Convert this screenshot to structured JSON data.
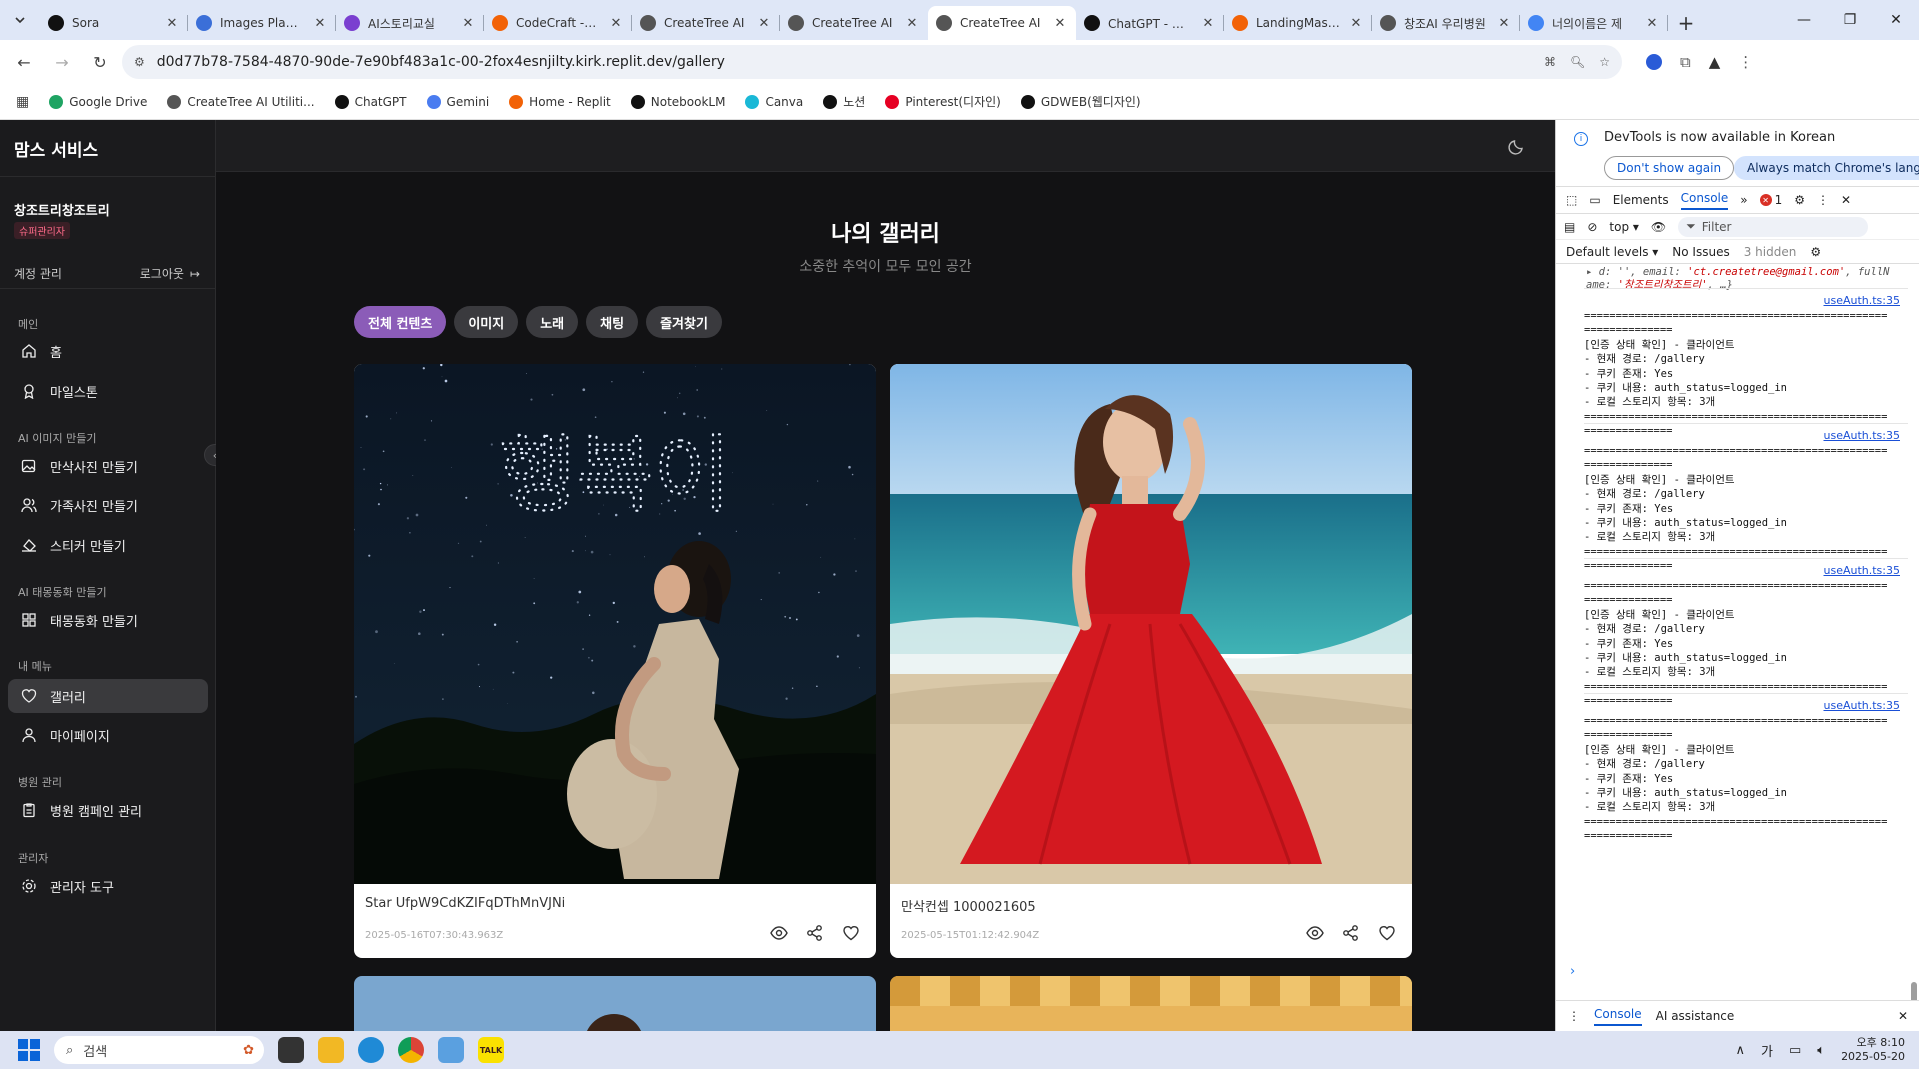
{
  "browser": {
    "tabs": [
      {
        "title": "Sora",
        "color": "#111111"
      },
      {
        "title": "Images Playground",
        "color": "#3b6fd8"
      },
      {
        "title": "AI스토리교실",
        "color": "#7a3fd0"
      },
      {
        "title": "CodeCraft - Replit",
        "color": "#f26207"
      },
      {
        "title": "CreateTree AI",
        "color": "#555555"
      },
      {
        "title": "CreateTree AI",
        "color": "#555555"
      },
      {
        "title": "CreateTree AI",
        "color": "#555555",
        "active": true
      },
      {
        "title": "ChatGPT - 창조",
        "color": "#111111"
      },
      {
        "title": "LandingMaster",
        "color": "#f26207"
      },
      {
        "title": "창조AI 우리병원",
        "color": "#555555"
      },
      {
        "title": "너의이름은 제",
        "color": "#4285f4"
      }
    ],
    "url": "d0d77b78-7584-4870-90de-7e90bf483a1c-00-2fox4esnjilty.kirk.replit.dev/gallery",
    "bookmarks": [
      {
        "label": "Google Drive",
        "color": "#1fa463"
      },
      {
        "label": "CreateTree AI Utiliti...",
        "color": "#555555"
      },
      {
        "label": "ChatGPT",
        "color": "#111111"
      },
      {
        "label": "Gemini",
        "color": "#4a7cf0"
      },
      {
        "label": "Home - Replit",
        "color": "#f26207"
      },
      {
        "label": "NotebookLM",
        "color": "#111111"
      },
      {
        "label": "Canva",
        "color": "#1ab8d6"
      },
      {
        "label": "노션",
        "color": "#111111"
      },
      {
        "label": "Pinterest(디자인)",
        "color": "#e60023"
      },
      {
        "label": "GDWEB(웹디자인)",
        "color": "#111111"
      }
    ]
  },
  "sidebar": {
    "brand": "맘스 서비스",
    "user_name": "창조트리창조트리",
    "role": "슈퍼관리자",
    "account_label": "계정 관리",
    "logout_label": "로그아웃",
    "sections": {
      "main": "메인",
      "ai_image": "AI 이미지 만들기",
      "ai_fetal": "AI 태몽동화 만들기",
      "my_menu": "내 메뉴",
      "hospital": "병원 관리",
      "admin": "관리자"
    },
    "items": {
      "home": "홈",
      "milestone": "마일스톤",
      "maternity_photo": "만삭사진 만들기",
      "family_photo": "가족사진 만들기",
      "sticker": "스티커 만들기",
      "fetal_story": "태몽동화 만들기",
      "gallery": "갤러리",
      "mypage": "마이페이지",
      "campaign": "병원 캠페인 관리",
      "admin_tools": "관리자 도구"
    }
  },
  "main": {
    "title": "나의 갤러리",
    "subtitle": "소중한 추억이 모두 모인 공간",
    "filters": [
      "전체 컨텐츠",
      "이미지",
      "노래",
      "채팅",
      "즐겨찾기"
    ],
    "active_filter": "전체 컨텐츠",
    "cards": [
      {
        "title": "Star UfpW9CdKZIFqDThMnVJNi",
        "date": "2025-05-16T07:30:43.963Z",
        "stars_text": "행복이"
      },
      {
        "title": "만삭컨셉 1000021605",
        "date": "2025-05-15T01:12:42.904Z"
      }
    ]
  },
  "devtools": {
    "info_message": "DevTools is now available in Korean",
    "dont_show": "Don't show again",
    "match_lang": "Always match Chrome's language",
    "tabs": [
      "Elements",
      "Console"
    ],
    "active_tab": "Console",
    "error_count": "1",
    "context": "top",
    "filter_placeholder": "Filter",
    "levels": "Default levels",
    "issues": "No Issues",
    "hidden": "3 hidden",
    "object_preview_1": "d: '', email: ",
    "object_email": "'ct.createtree@gmail.com'",
    "object_preview_2": ", fullN",
    "object_preview_3": "ame: ",
    "object_name": "'창조트리창조트리'",
    "object_preview_4": ", …}",
    "log_source": "useAuth.ts:35",
    "log_lines": [
      "================================================",
      "==============",
      "[인증 상태 확인] - 클라이언트",
      "- 현재 경로: /gallery",
      "- 쿠키 존재: Yes",
      "- 쿠키 내용: auth_status=logged_in",
      "- 로컬 스토리지 항목: 3개",
      "================================================",
      "=============="
    ],
    "drawer_tabs": [
      "Console",
      "AI assistance"
    ]
  },
  "taskbar": {
    "search_placeholder": "검색",
    "ime": "가",
    "time": "오후 8:10",
    "date": "2025-05-20"
  }
}
